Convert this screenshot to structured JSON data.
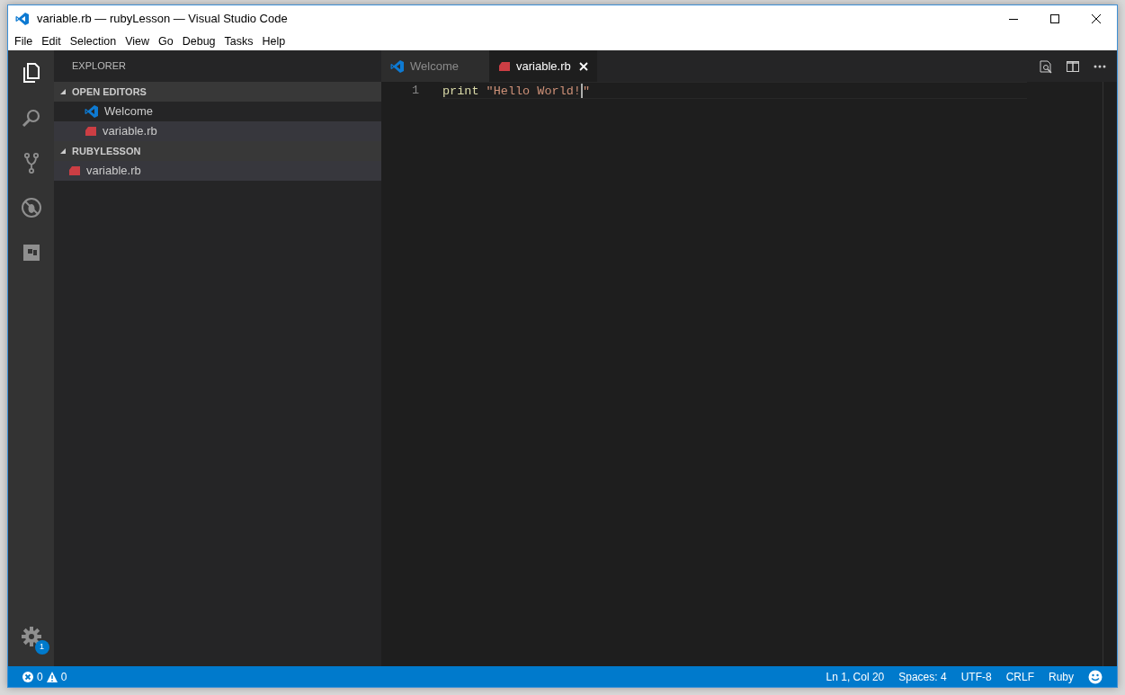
{
  "window": {
    "title": "variable.rb — rubyLesson — Visual Studio Code"
  },
  "menu": [
    "File",
    "Edit",
    "Selection",
    "View",
    "Go",
    "Debug",
    "Tasks",
    "Help"
  ],
  "activity_bar": {
    "items": [
      {
        "kind": "files",
        "selected": true
      },
      {
        "kind": "search",
        "selected": false
      },
      {
        "kind": "git",
        "selected": false
      },
      {
        "kind": "debug",
        "selected": false
      },
      {
        "kind": "extensions",
        "selected": false
      }
    ],
    "settings_badge": "1"
  },
  "sidebar": {
    "title": "EXPLORER",
    "sections": [
      {
        "title": "OPEN EDITORS",
        "expanded": true,
        "items": [
          {
            "label": "Welcome",
            "kind": "welcome",
            "selected": false
          },
          {
            "label": "variable.rb",
            "kind": "ruby",
            "selected": true
          }
        ]
      },
      {
        "title": "RUBYLESSON",
        "expanded": true,
        "items": [
          {
            "label": "variable.rb",
            "kind": "ruby",
            "selected": true
          }
        ]
      }
    ]
  },
  "tabs": [
    {
      "label": "Welcome",
      "kind": "welcome",
      "selected": false
    },
    {
      "label": "variable.rb",
      "kind": "ruby",
      "selected": true
    }
  ],
  "editor": {
    "lines": [
      {
        "number": "1",
        "tokens": [
          {
            "text": "print",
            "kind": "function",
            "cursor": false
          },
          {
            "text": " \"Hello World!",
            "kind": "string",
            "cursor": true
          },
          {
            "text": "\"",
            "kind": "string",
            "cursor": false
          }
        ]
      }
    ]
  },
  "status_bar": {
    "errors": "0",
    "warnings": "0",
    "items": [
      "Ln 1, Col 20",
      "Spaces: 4",
      "UTF-8",
      "CRLF",
      "Ruby"
    ]
  }
}
